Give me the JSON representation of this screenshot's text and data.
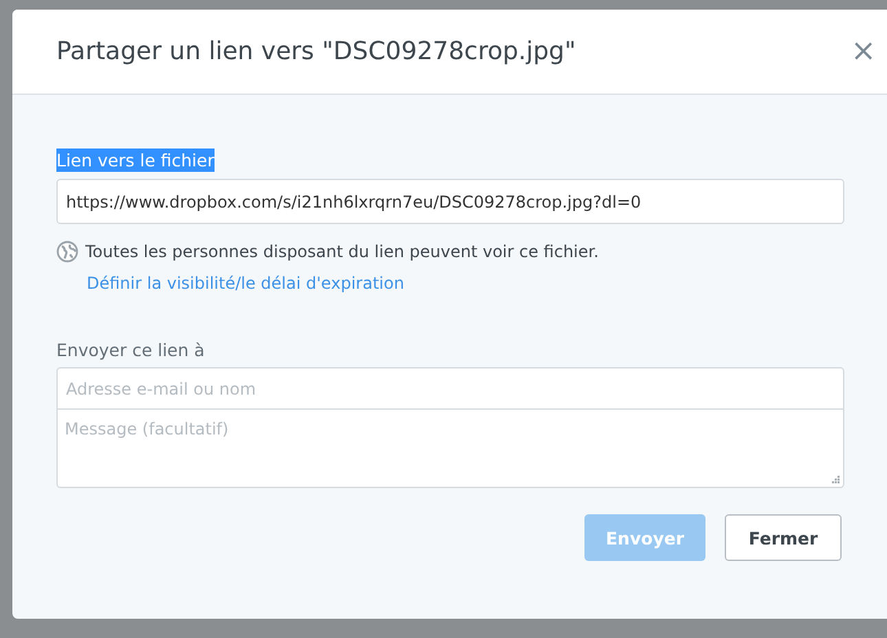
{
  "dialog": {
    "title": "Partager un lien vers \"DSC09278crop.jpg\"",
    "close": "×"
  },
  "link_section": {
    "label": "Lien vers le fichier",
    "label_highlighted": true,
    "url": "https://www.dropbox.com/s/i21nh6lxrqrn7eu/DSC09278crop.jpg?dl=0",
    "notice": "Toutes les personnes disposant du lien peuvent voir ce fichier.",
    "settings_link": "Définir la visibilité/le délai d'expiration"
  },
  "send_section": {
    "label": "Envoyer ce lien à",
    "recipient": {
      "placeholder": "Adresse e-mail ou nom"
    },
    "message": {
      "placeholder": "Message (facultatif)"
    }
  },
  "buttons": [
    {
      "kind": "primary",
      "label": "Envoyer",
      "disabled": true
    },
    {
      "kind": "secondary",
      "label": "Fermer",
      "disabled": false
    }
  ]
}
